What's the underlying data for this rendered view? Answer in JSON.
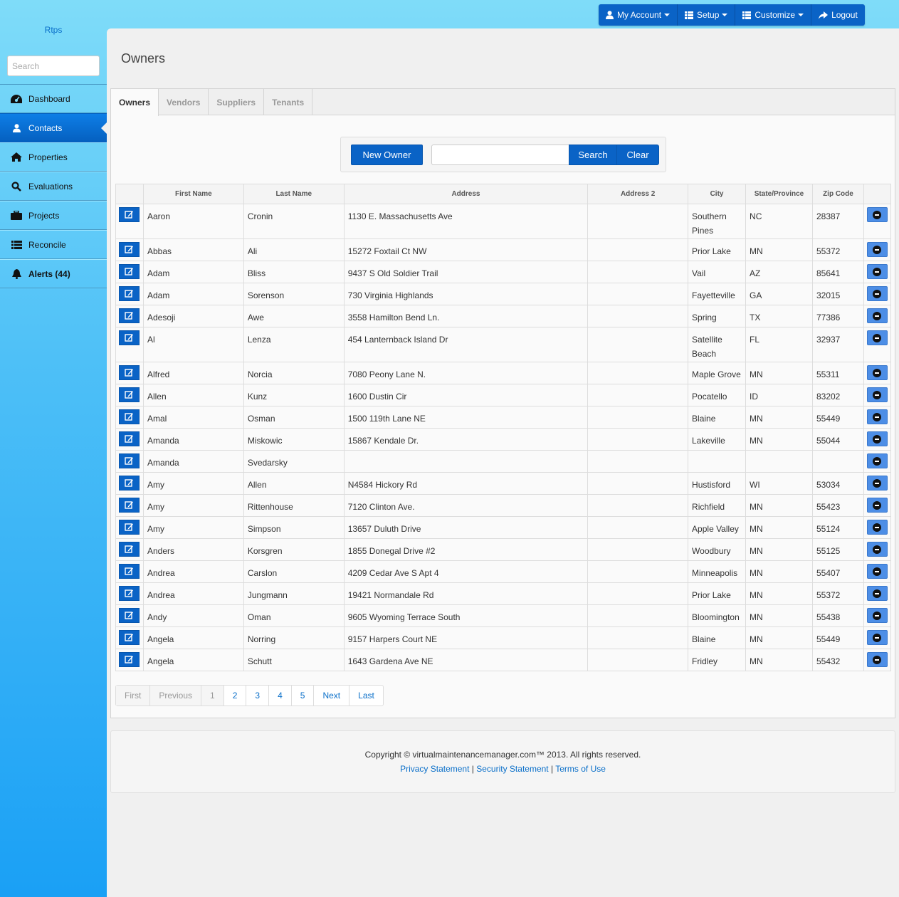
{
  "brand": "Rtps",
  "sidebar": {
    "search_placeholder": "Search",
    "items": [
      {
        "label": "Dashboard",
        "icon": "dashboard-icon"
      },
      {
        "label": "Contacts",
        "icon": "user-icon"
      },
      {
        "label": "Properties",
        "icon": "home-icon"
      },
      {
        "label": "Evaluations",
        "icon": "search-icon"
      },
      {
        "label": "Projects",
        "icon": "briefcase-icon"
      },
      {
        "label": "Reconcile",
        "icon": "list-icon"
      },
      {
        "label": "Alerts (44)",
        "icon": "bell-icon"
      }
    ]
  },
  "topnav": {
    "my_account": "My Account",
    "setup": "Setup",
    "customize": "Customize",
    "logout": "Logout"
  },
  "page": {
    "title": "Owners"
  },
  "tabs": [
    "Owners",
    "Vendors",
    "Suppliers",
    "Tenants"
  ],
  "searchbar": {
    "new_label": "New Owner",
    "search_label": "Search",
    "clear_label": "Clear",
    "query": ""
  },
  "table": {
    "headers": [
      "First Name",
      "Last Name",
      "Address",
      "Address 2",
      "City",
      "State/Province",
      "Zip Code"
    ],
    "rows": [
      [
        "Aaron",
        "Cronin",
        "1130 E. Massachusetts Ave",
        "",
        "Southern Pines",
        "NC",
        "28387"
      ],
      [
        "Abbas",
        "Ali",
        "15272 Foxtail Ct NW",
        "",
        "Prior Lake",
        "MN",
        "55372"
      ],
      [
        "Adam",
        "Bliss",
        "9437 S Old Soldier Trail",
        "",
        "Vail",
        "AZ",
        "85641"
      ],
      [
        "Adam",
        "Sorenson",
        "730 Virginia Highlands",
        "",
        "Fayetteville",
        "GA",
        "32015"
      ],
      [
        "Adesoji",
        "Awe",
        "3558 Hamilton Bend Ln.",
        "",
        "Spring",
        "TX",
        "77386"
      ],
      [
        "Al",
        "Lenza",
        "454 Lanternback Island Dr",
        "",
        "Satellite Beach",
        "FL",
        "32937"
      ],
      [
        "Alfred",
        "Norcia",
        "7080 Peony Lane N.",
        "",
        "Maple Grove",
        "MN",
        "55311"
      ],
      [
        "Allen",
        "Kunz",
        "1600 Dustin Cir",
        "",
        "Pocatello",
        "ID",
        "83202"
      ],
      [
        "Amal",
        "Osman",
        "1500 119th Lane NE",
        "",
        "Blaine",
        "MN",
        "55449"
      ],
      [
        "Amanda",
        "Miskowic",
        "15867 Kendale Dr.",
        "",
        "Lakeville",
        "MN",
        "55044"
      ],
      [
        "Amanda",
        "Svedarsky",
        "",
        "",
        "",
        "",
        ""
      ],
      [
        "Amy",
        "Allen",
        "N4584 Hickory Rd",
        "",
        "Hustisford",
        "WI",
        "53034"
      ],
      [
        "Amy",
        "Rittenhouse",
        "7120 Clinton Ave.",
        "",
        "Richfield",
        "MN",
        "55423"
      ],
      [
        "Amy",
        "Simpson",
        "13657 Duluth Drive",
        "",
        "Apple Valley",
        "MN",
        "55124"
      ],
      [
        "Anders",
        "Korsgren",
        "1855 Donegal Drive #2",
        "",
        "Woodbury",
        "MN",
        "55125"
      ],
      [
        "Andrea",
        "Carslon",
        "4209 Cedar Ave S Apt 4",
        "",
        "Minneapolis",
        "MN",
        "55407"
      ],
      [
        "Andrea",
        "Jungmann",
        "19421 Normandale Rd",
        "",
        "Prior Lake",
        "MN",
        "55372"
      ],
      [
        "Andy",
        "Oman",
        "9605 Wyoming Terrace South",
        "",
        "Bloomington",
        "MN",
        "55438"
      ],
      [
        "Angela",
        "Norring",
        "9157 Harpers Court NE",
        "",
        "Blaine",
        "MN",
        "55449"
      ],
      [
        "Angela",
        "Schutt",
        "1643 Gardena Ave NE",
        "",
        "Fridley",
        "MN",
        "55432"
      ]
    ]
  },
  "pager": [
    "First",
    "Previous",
    "1",
    "2",
    "3",
    "4",
    "5",
    "Next",
    "Last"
  ],
  "footer": {
    "copyright": "Copyright © virtualmaintenancemanager.com™ 2013. All rights reserved.",
    "privacy": "Privacy Statement",
    "security": "Security Statement",
    "terms": "Terms of Use",
    "separator": "|"
  },
  "colors": {
    "primary": "#0a63c6",
    "delete": "#4d8ee6",
    "link": "#0a6fc9"
  }
}
